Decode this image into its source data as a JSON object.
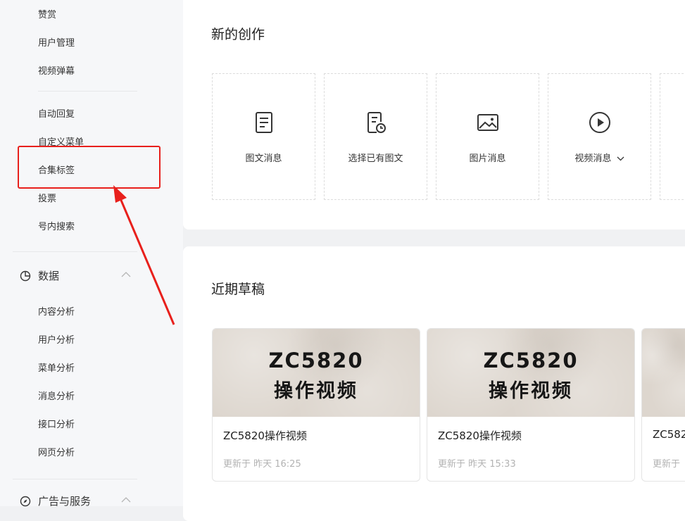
{
  "sidebar": {
    "items_top": [
      "赞赏",
      "用户管理",
      "视频弹幕"
    ],
    "items_func": [
      "自动回复",
      "自定义菜单",
      "合集标签",
      "投票",
      "号内搜索"
    ],
    "group_data": {
      "label": "数据",
      "icon": "pie-chart-icon"
    },
    "items_data": [
      "内容分析",
      "用户分析",
      "菜单分析",
      "消息分析",
      "接口分析",
      "网页分析"
    ],
    "group_ads": {
      "label": "广告与服务",
      "icon": "compass-icon"
    }
  },
  "new_creation": {
    "title": "新的创作",
    "items": [
      {
        "label": "图文消息",
        "icon": "document-icon"
      },
      {
        "label": "选择已有图文",
        "icon": "document-clock-icon"
      },
      {
        "label": "图片消息",
        "icon": "image-icon"
      },
      {
        "label": "视频消息",
        "icon": "play-circle-icon",
        "has_dropdown": true
      }
    ]
  },
  "recent_drafts": {
    "title": "近期草稿",
    "items": [
      {
        "thumb_line1": "ZC5820",
        "thumb_line2": "操作视频",
        "title": "ZC5820操作视频",
        "updated": "更新于 昨天 16:25"
      },
      {
        "thumb_line1": "ZC5820",
        "thumb_line2": "操作视频",
        "title": "ZC5820操作视频",
        "updated": "更新于 昨天 15:33"
      },
      {
        "thumb_line1": "",
        "thumb_line2": "",
        "title": "ZC582",
        "updated": "更新于"
      }
    ]
  },
  "annotation": {
    "color": "#e8201c"
  },
  "colors": {
    "sidebar_bg": "#f6f7f9",
    "page_bg": "#f0f1f3",
    "text": "#353535",
    "muted": "#b3b3b3"
  }
}
